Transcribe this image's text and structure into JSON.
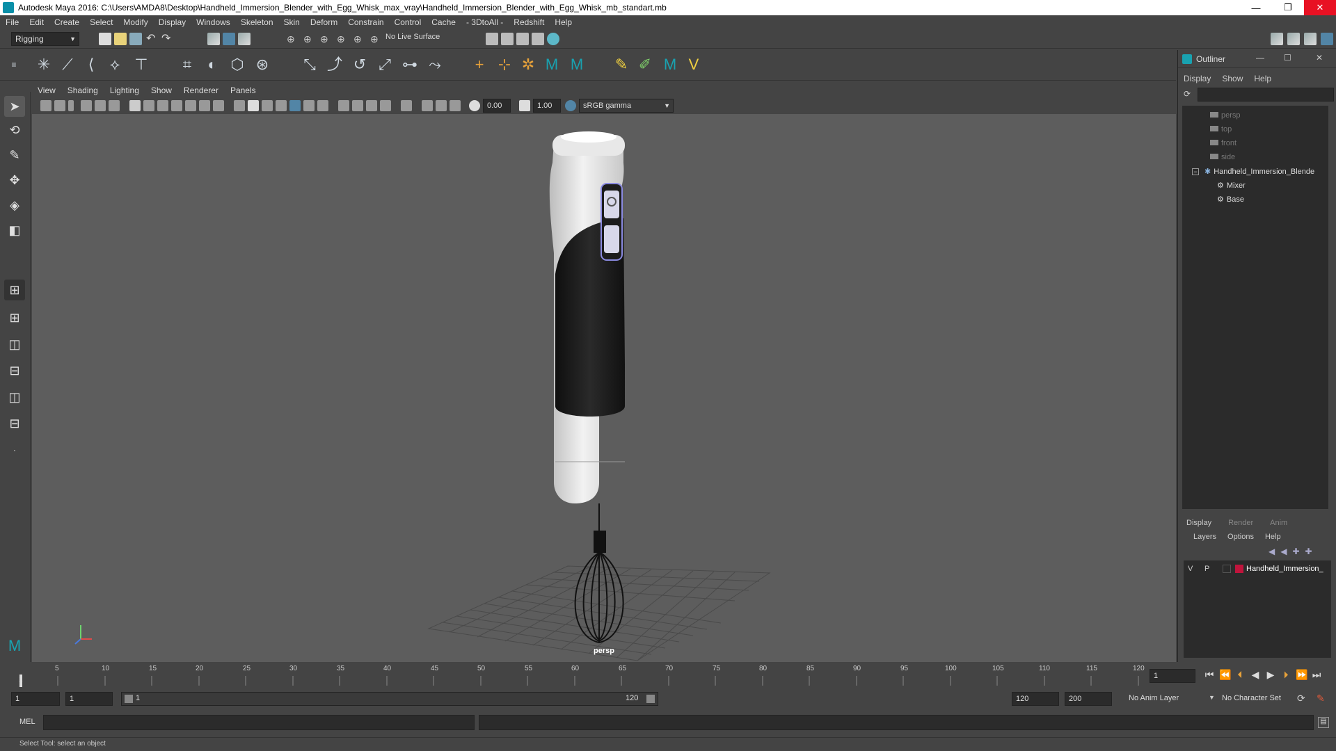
{
  "window": {
    "title": "Autodesk Maya 2016: C:\\Users\\AMDA8\\Desktop\\Handheld_Immersion_Blender_with_Egg_Whisk_max_vray\\Handheld_Immersion_Blender_with_Egg_Whisk_mb_standart.mb",
    "controls": [
      "—",
      "❐",
      "✕"
    ]
  },
  "menubar": [
    "File",
    "Edit",
    "Create",
    "Select",
    "Modify",
    "Display",
    "Windows",
    "Skeleton",
    "Skin",
    "Deform",
    "Constrain",
    "Control",
    "Cache",
    "- 3DtoAll -",
    "Redshift",
    "Help"
  ],
  "statusline": {
    "mode": "Rigging",
    "live_surface": "No Live Surface"
  },
  "viewport": {
    "menu": [
      "View",
      "Shading",
      "Lighting",
      "Show",
      "Renderer",
      "Panels"
    ],
    "field_a": "0.00",
    "field_b": "1.00",
    "color_space": "sRGB gamma",
    "camera_label": "persp"
  },
  "outliner": {
    "title": "Outliner",
    "menu": [
      "Display",
      "Show",
      "Help"
    ],
    "items": [
      {
        "label": "persp",
        "dim": true
      },
      {
        "label": "top",
        "dim": true
      },
      {
        "label": "front",
        "dim": true
      },
      {
        "label": "side",
        "dim": true
      },
      {
        "label": "Handheld_Immersion_Blende",
        "dim": false
      },
      {
        "label": "Mixer",
        "dim": false
      },
      {
        "label": "Base",
        "dim": false
      }
    ]
  },
  "layers": {
    "tabs": [
      "Display",
      "Render",
      "Anim"
    ],
    "menu": [
      "Layers",
      "Options",
      "Help"
    ],
    "row": {
      "v": "V",
      "p": "P",
      "name": "Handheld_Immersion_",
      "color": "#c0143c"
    }
  },
  "timeline": {
    "ticks": [
      "5",
      "10",
      "15",
      "20",
      "25",
      "30",
      "35",
      "40",
      "45",
      "50",
      "55",
      "60",
      "65",
      "70",
      "75",
      "80",
      "85",
      "90",
      "95",
      "100",
      "105",
      "110",
      "115",
      "120"
    ],
    "current_frame": "1"
  },
  "range": {
    "start": "1",
    "playback_start": "1",
    "slider_start": "1",
    "slider_end": "120",
    "playback_end": "120",
    "end": "200",
    "anim_layer": "No Anim Layer",
    "character_set": "No Character Set"
  },
  "cmdline": {
    "label": "MEL"
  },
  "helpline": {
    "text": "Select Tool: select an object"
  },
  "colors": {
    "accent": "#5285a6",
    "layer_color": "#c0143c"
  }
}
